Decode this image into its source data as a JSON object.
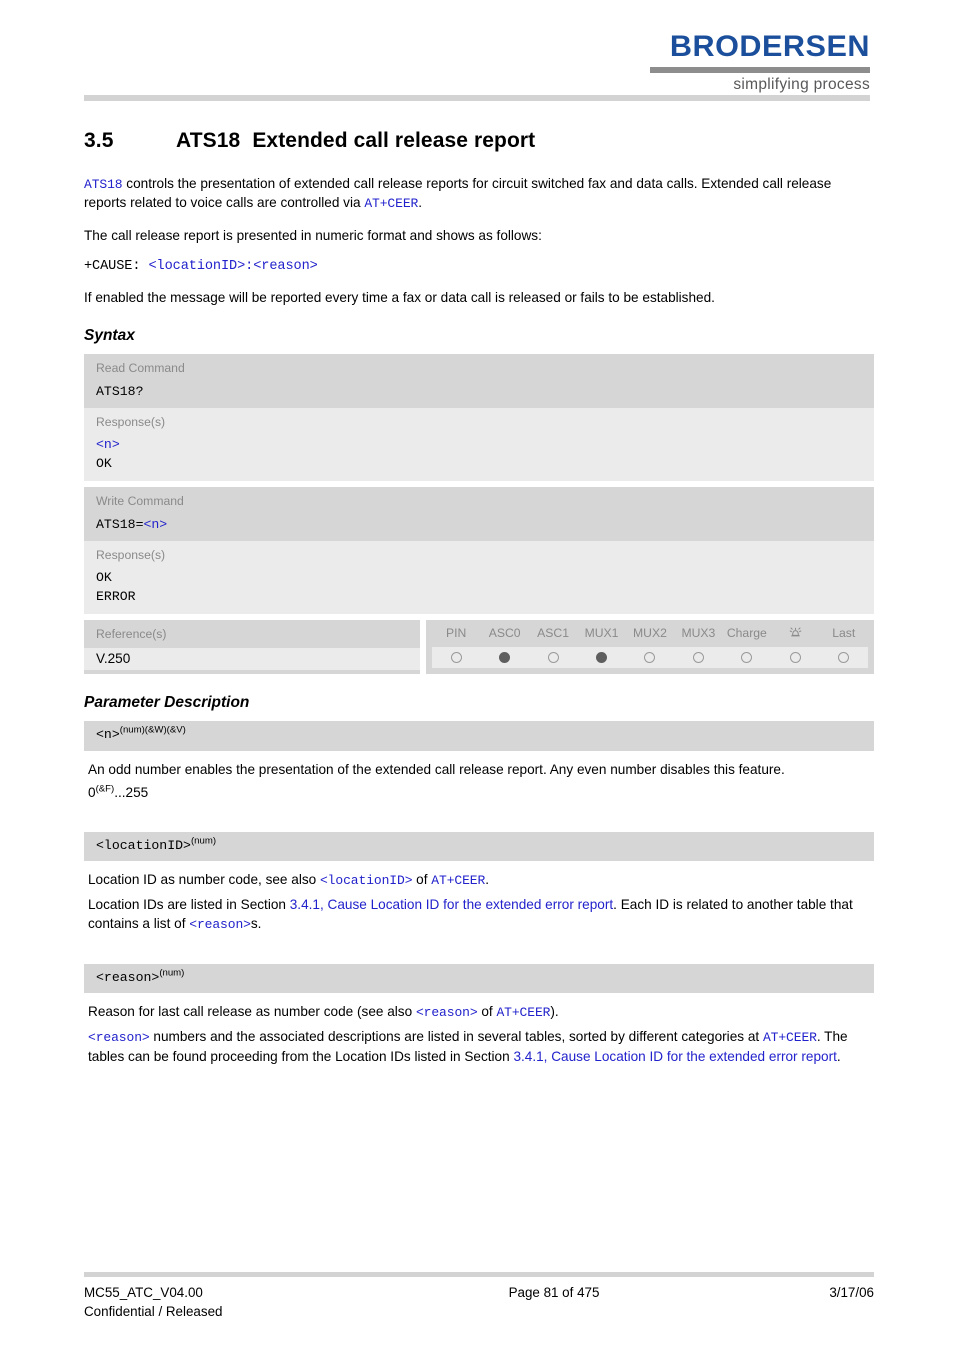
{
  "header": {
    "logo_word": "BRODERSEN",
    "logo_tagline": "simplifying process"
  },
  "section": {
    "number": "3.5",
    "command": "ATS18",
    "title": "Extended call release report"
  },
  "intro": {
    "p1_cmd": "ATS18",
    "p1_text_a": " controls the presentation of extended call release reports for circuit switched fax and data calls. Extended call release reports related to voice calls are controlled via ",
    "p1_cmd2": "AT+CEER",
    "p1_text_b": ".",
    "p2": "The call release report is presented in numeric format and shows as follows:",
    "p3_plain": "+CAUSE: ",
    "p3_params": "<locationID>:<reason>",
    "p4": "If enabled the message will be reported every time a fax or data call is released or fails to be established."
  },
  "syntax": {
    "heading": "Syntax",
    "read": {
      "label": "Read Command",
      "code": "ATS18?",
      "response_label": "Response(s)",
      "response_param": "<n>",
      "response_ok": "OK"
    },
    "write": {
      "label": "Write Command",
      "code_plain": "ATS18=",
      "code_param": "<n>",
      "response_label": "Response(s)",
      "response_ok": "OK",
      "response_error": "ERROR"
    },
    "reference": {
      "label": "Reference(s)",
      "value": "V.250"
    },
    "capabilities": {
      "columns": [
        "PIN",
        "ASC0",
        "ASC1",
        "MUX1",
        "MUX2",
        "MUX3",
        "Charge",
        "wake-up-icon",
        "Last"
      ],
      "states": [
        "empty",
        "filled",
        "empty",
        "filled",
        "empty",
        "empty",
        "empty",
        "empty",
        "empty"
      ]
    }
  },
  "parameters": {
    "heading": "Parameter Description",
    "items": [
      {
        "name": "<n>",
        "superscript": "(num)(&W)(&V)",
        "desc": "An odd number enables the presentation of the extended call release report. Any even number disables this feature.",
        "range_value": "0",
        "range_sup": "(&F)",
        "range_rest": "...255"
      },
      {
        "name": "<locationID>",
        "superscript": "(num)",
        "line1_a": "Location ID as number code, see also ",
        "line1_param": "<locationID>",
        "line1_b": " of ",
        "line1_cmd": "AT+CEER",
        "line1_c": ".",
        "line2_a": "Location IDs are listed in Section ",
        "line2_link": "3.4.1, Cause Location ID for the extended error report",
        "line2_b": ". Each ID is related to another table that contains a list of ",
        "line2_param": "<reason>",
        "line2_c": "s."
      },
      {
        "name": "<reason>",
        "superscript": "(num)",
        "line1_a": "Reason for last call release as number code (see also ",
        "line1_param": "<reason>",
        "line1_b": " of ",
        "line1_cmd": "AT+CEER",
        "line1_c": ").",
        "line2_param": "<reason>",
        "line2_a": " numbers and the associated descriptions are listed in several tables, sorted by different categories at ",
        "line2_cmd": "AT+CEER",
        "line2_b": ". The tables can be found proceeding from the Location IDs listed in Section ",
        "line2_link": "3.4.1, Cause Location ID for the extended error report",
        "line2_c": "."
      }
    ]
  },
  "footer": {
    "doc_id": "MC55_ATC_V04.00",
    "classification": "Confidential / Released",
    "page": "Page 81 of 475",
    "date": "3/17/06"
  },
  "colors": {
    "brand_blue": "#1b4f9c",
    "code_blue": "#2222cc",
    "band_dark": "#d6d6d6",
    "band_light": "#ebebeb"
  }
}
